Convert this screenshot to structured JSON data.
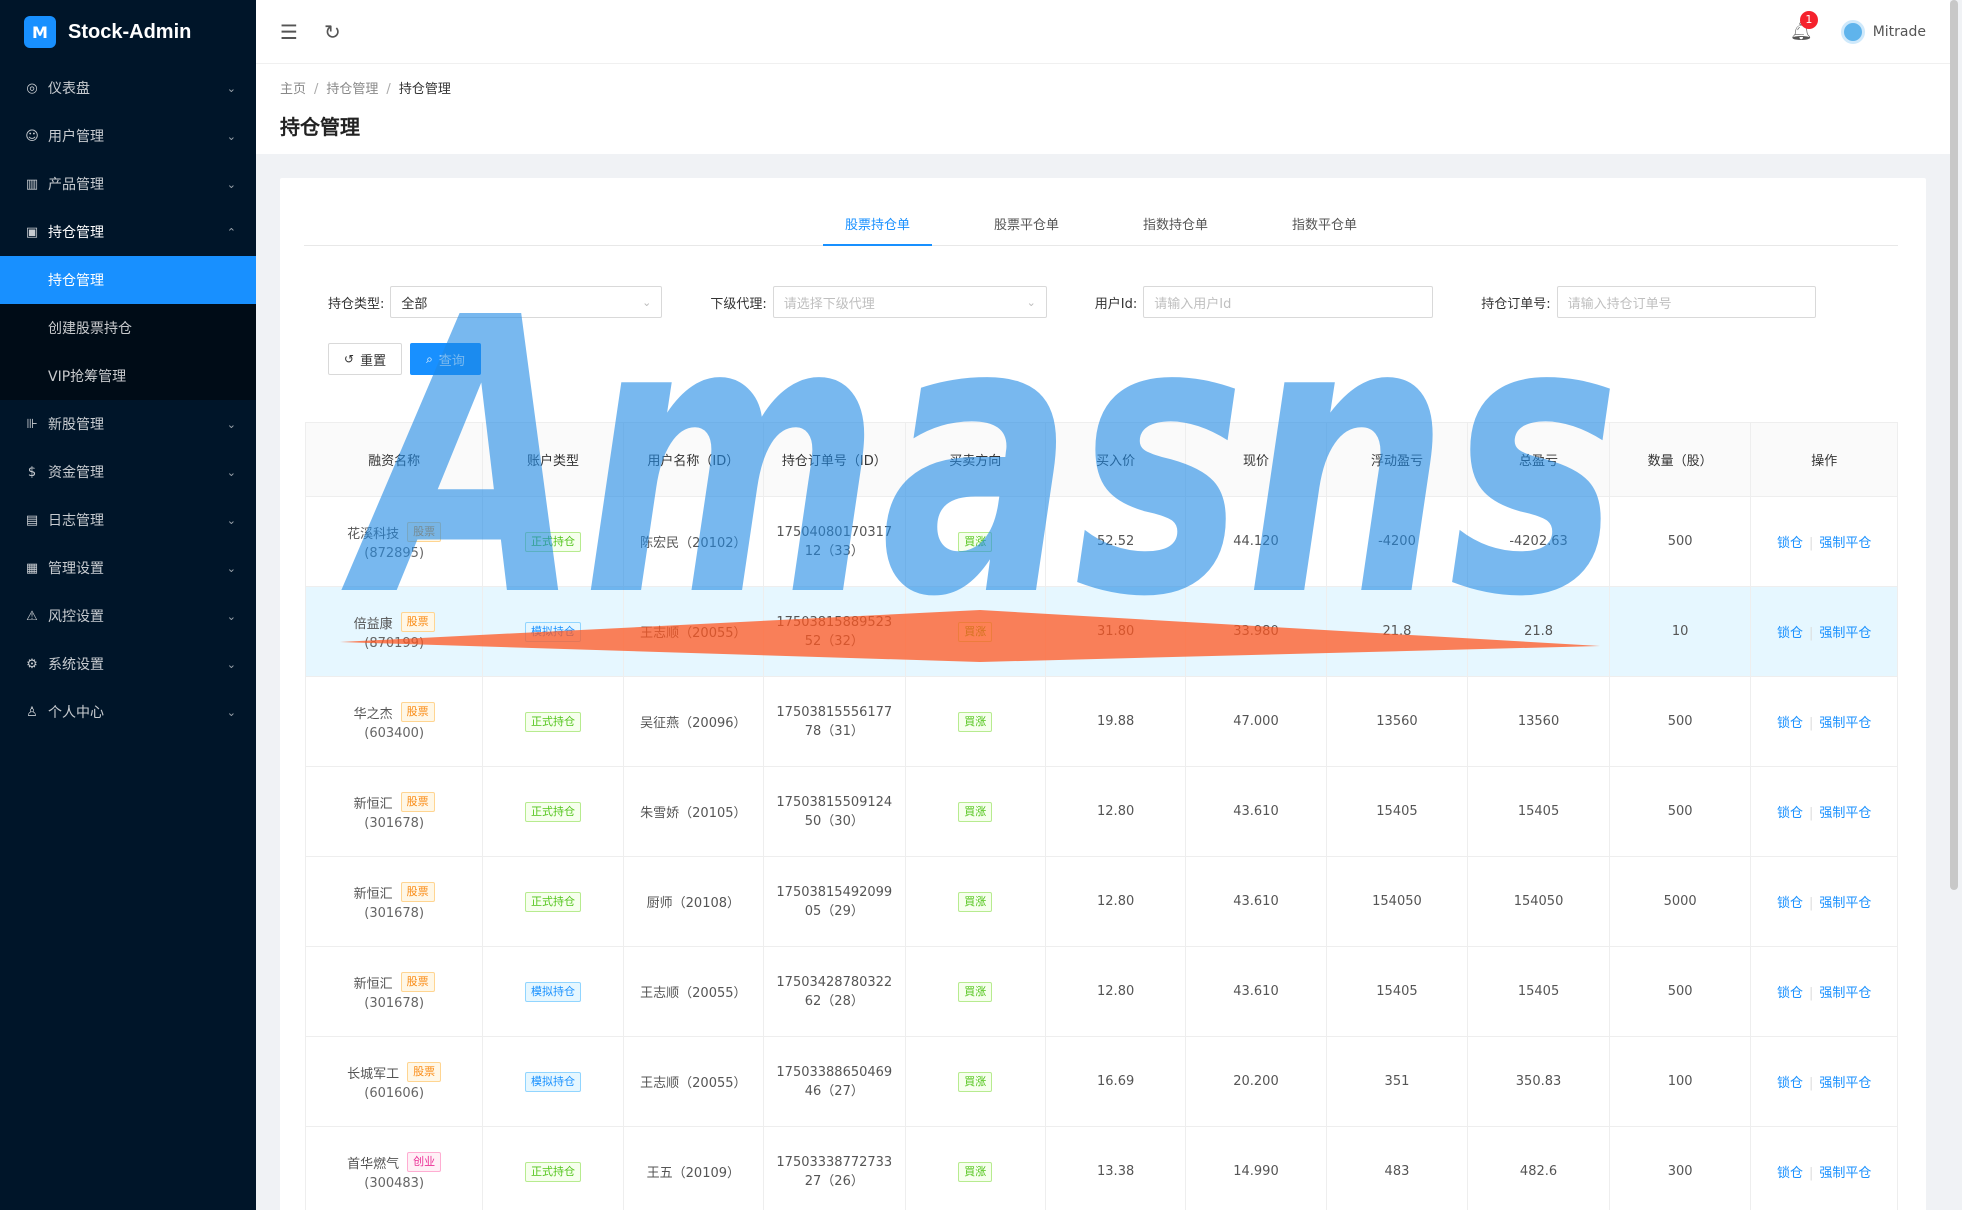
{
  "app": {
    "name": "Stock-Admin",
    "logo_glyph": "M"
  },
  "sidebar": {
    "items": [
      {
        "label": "仪表盘",
        "icon": "dashboard-icon",
        "glyph": "◎"
      },
      {
        "label": "用户管理",
        "icon": "user-manage-icon",
        "glyph": "☺"
      },
      {
        "label": "产品管理",
        "icon": "chart-icon",
        "glyph": "▥"
      },
      {
        "label": "持仓管理",
        "icon": "position-icon",
        "glyph": "▣"
      },
      {
        "label": "新股管理",
        "icon": "new-stock-icon",
        "glyph": "⊪"
      },
      {
        "label": "资金管理",
        "icon": "money-icon",
        "glyph": "$"
      },
      {
        "label": "日志管理",
        "icon": "log-icon",
        "glyph": "▤"
      },
      {
        "label": "管理设置",
        "icon": "setting-grid-icon",
        "glyph": "▦"
      },
      {
        "label": "风控设置",
        "icon": "warning-icon",
        "glyph": "⚠"
      },
      {
        "label": "系统设置",
        "icon": "gear-icon",
        "glyph": "⚙"
      },
      {
        "label": "个人中心",
        "icon": "person-icon",
        "glyph": "♙"
      }
    ],
    "submenu": [
      {
        "label": "持仓管理"
      },
      {
        "label": "创建股票持仓"
      },
      {
        "label": "VIP抢筹管理"
      }
    ]
  },
  "header": {
    "notification_count": "1",
    "username": "Mitrade"
  },
  "breadcrumb": [
    "主页",
    "持仓管理",
    "持仓管理"
  ],
  "page_title": "持仓管理",
  "tabs": [
    "股票持仓单",
    "股票平仓单",
    "指数持仓单",
    "指数平仓单"
  ],
  "filters": {
    "type_label": "持仓类型:",
    "type_value": "全部",
    "agent_label": "下级代理:",
    "agent_placeholder": "请选择下级代理",
    "userid_label": "用户Id:",
    "userid_placeholder": "请输入用户Id",
    "order_label": "持仓订单号:",
    "order_placeholder": "请输入持仓订单号"
  },
  "buttons": {
    "reset": "重置",
    "search": "查询"
  },
  "table": {
    "columns": [
      "融资名称",
      "账户类型",
      "用户名称（ID）",
      "持仓订单号（ID）",
      "买卖方向",
      "买入价",
      "现价",
      "浮动盈亏",
      "总盈亏",
      "数量（股）",
      "操作"
    ],
    "rows": [
      {
        "name": "花溪科技",
        "tag": "股票",
        "code": "(872895)",
        "account": "正式持仓",
        "user": "陈宏民（20102）",
        "order1": "17504080170317",
        "order2": "12（33）",
        "dir": "買涨",
        "buy": "52.52",
        "now": "44.120",
        "float": "-4200",
        "total": "-4202.63",
        "qty": "500",
        "lock": "锁仓",
        "close": "强制平仓"
      },
      {
        "name": "倍益康",
        "tag": "股票",
        "code": "(870199)",
        "account": "模拟持仓",
        "user": "王志顺（20055）",
        "order1": "17503815889523",
        "order2": "52（32）",
        "dir": "買涨",
        "buy": "31.80",
        "now": "33.980",
        "float": "21.8",
        "total": "21.8",
        "qty": "10",
        "lock": "锁仓",
        "close": "强制平仓"
      },
      {
        "name": "华之杰",
        "tag": "股票",
        "code": "(603400)",
        "account": "正式持仓",
        "user": "吴征燕（20096）",
        "order1": "17503815556177",
        "order2": "78（31）",
        "dir": "買涨",
        "buy": "19.88",
        "now": "47.000",
        "float": "13560",
        "total": "13560",
        "qty": "500",
        "lock": "锁仓",
        "close": "强制平仓"
      },
      {
        "name": "新恒汇",
        "tag": "股票",
        "code": "(301678)",
        "account": "正式持仓",
        "user": "朱雪娇（20105）",
        "order1": "17503815509124",
        "order2": "50（30）",
        "dir": "買涨",
        "buy": "12.80",
        "now": "43.610",
        "float": "15405",
        "total": "15405",
        "qty": "500",
        "lock": "锁仓",
        "close": "强制平仓"
      },
      {
        "name": "新恒汇",
        "tag": "股票",
        "code": "(301678)",
        "account": "正式持仓",
        "user": "厨师（20108）",
        "order1": "17503815492099",
        "order2": "05（29）",
        "dir": "買涨",
        "buy": "12.80",
        "now": "43.610",
        "float": "154050",
        "total": "154050",
        "qty": "5000",
        "lock": "锁仓",
        "close": "强制平仓"
      },
      {
        "name": "新恒汇",
        "tag": "股票",
        "code": "(301678)",
        "account": "模拟持仓",
        "user": "王志顺（20055）",
        "order1": "17503428780322",
        "order2": "62（28）",
        "dir": "買涨",
        "buy": "12.80",
        "now": "43.610",
        "float": "15405",
        "total": "15405",
        "qty": "500",
        "lock": "锁仓",
        "close": "强制平仓"
      },
      {
        "name": "长城军工",
        "tag": "股票",
        "code": "(601606)",
        "account": "模拟持仓",
        "user": "王志顺（20055）",
        "order1": "17503388650469",
        "order2": "46（27）",
        "dir": "買涨",
        "buy": "16.69",
        "now": "20.200",
        "float": "351",
        "total": "350.83",
        "qty": "100",
        "lock": "锁仓",
        "close": "强制平仓"
      },
      {
        "name": "首华燃气",
        "tag": "创业",
        "code": "(300483)",
        "account": "正式持仓",
        "user": "王五（20109）",
        "order1": "17503338772733",
        "order2": "27（26）",
        "dir": "買涨",
        "buy": "13.38",
        "now": "14.990",
        "float": "483",
        "total": "482.6",
        "qty": "300",
        "lock": "锁仓",
        "close": "强制平仓"
      }
    ]
  },
  "watermark": {
    "text": "Amasns",
    "color": "#1e88e5",
    "accent": "#ff5722"
  }
}
